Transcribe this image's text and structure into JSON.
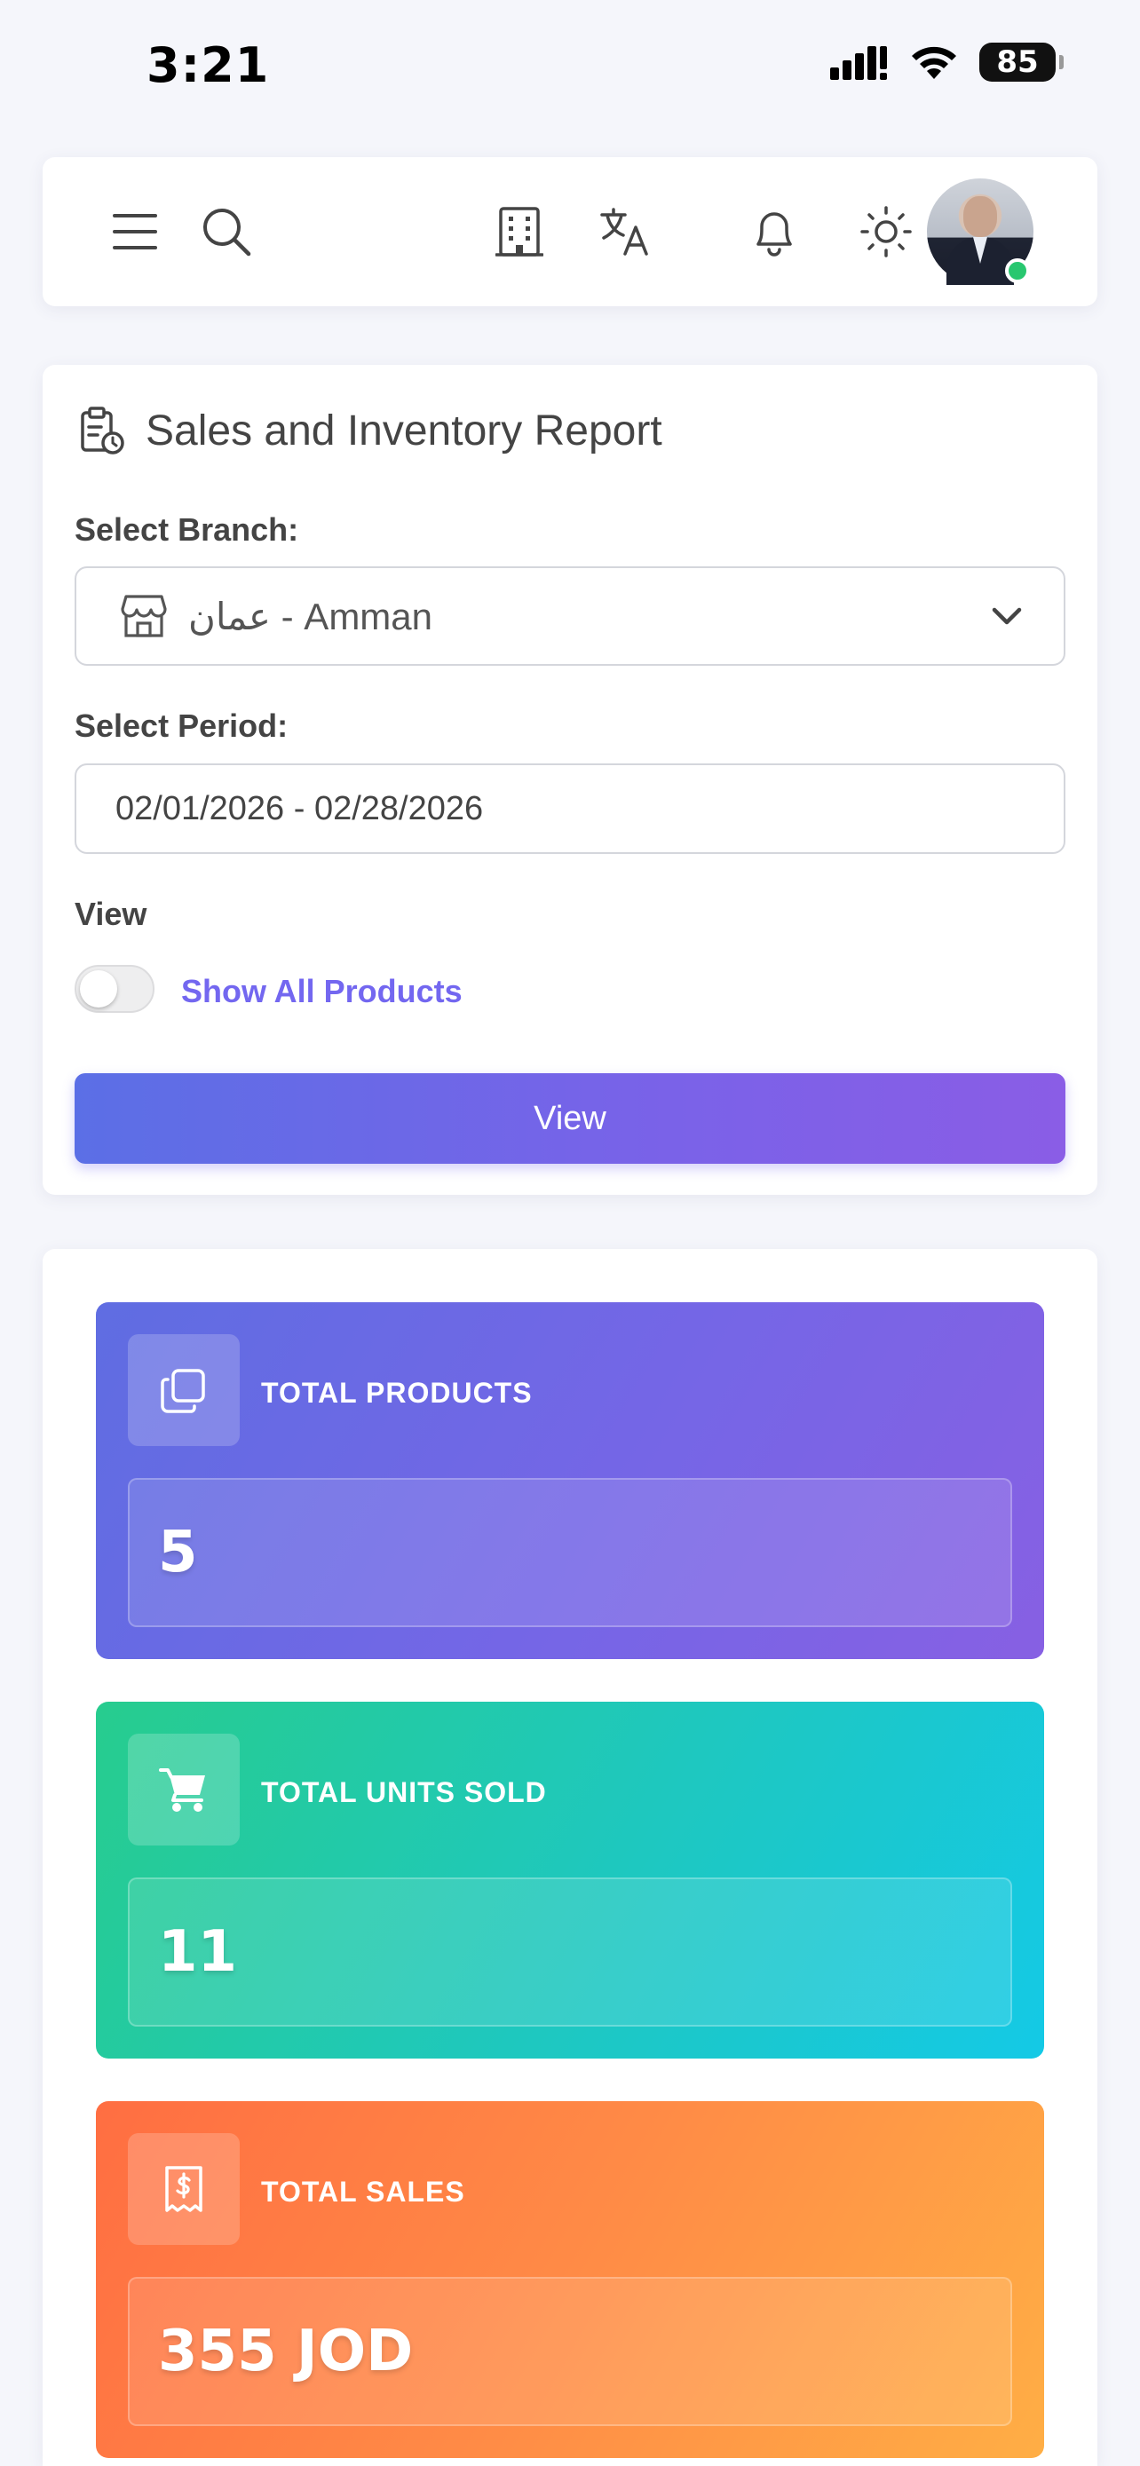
{
  "status_bar": {
    "time": "3:21",
    "battery": "85"
  },
  "icons": {
    "menu": "menu-icon",
    "search": "search-icon",
    "building": "building-icon",
    "translate": "translate-icon",
    "bell": "bell-icon",
    "sun": "sun-icon",
    "report": "clipboard-clock-icon",
    "store": "store-icon",
    "chevron": "chevron-down-icon",
    "copy": "copy-icon",
    "cart": "cart-icon",
    "receipt": "receipt-dollar-icon"
  },
  "report": {
    "title": "Sales and Inventory Report",
    "branch_label": "Select Branch:",
    "branch_value": "عمان - Amman",
    "period_label": "Select Period:",
    "period_value": "02/01/2026 - 02/28/2026",
    "view_label": "View",
    "toggle_label": "Show All Products",
    "toggle_on": false,
    "button_label": "View"
  },
  "stats": [
    {
      "label": "TOTAL PRODUCTS",
      "value": "5"
    },
    {
      "label": "TOTAL UNITS SOLD",
      "value": "11"
    },
    {
      "label": "TOTAL SALES",
      "value": "355 JOD"
    }
  ],
  "colors": {
    "accent": "#7367f0",
    "products": "#6a68e4",
    "units_sold": "#1fc9b4",
    "sales": "#ff8a45",
    "online": "#28c76f"
  }
}
